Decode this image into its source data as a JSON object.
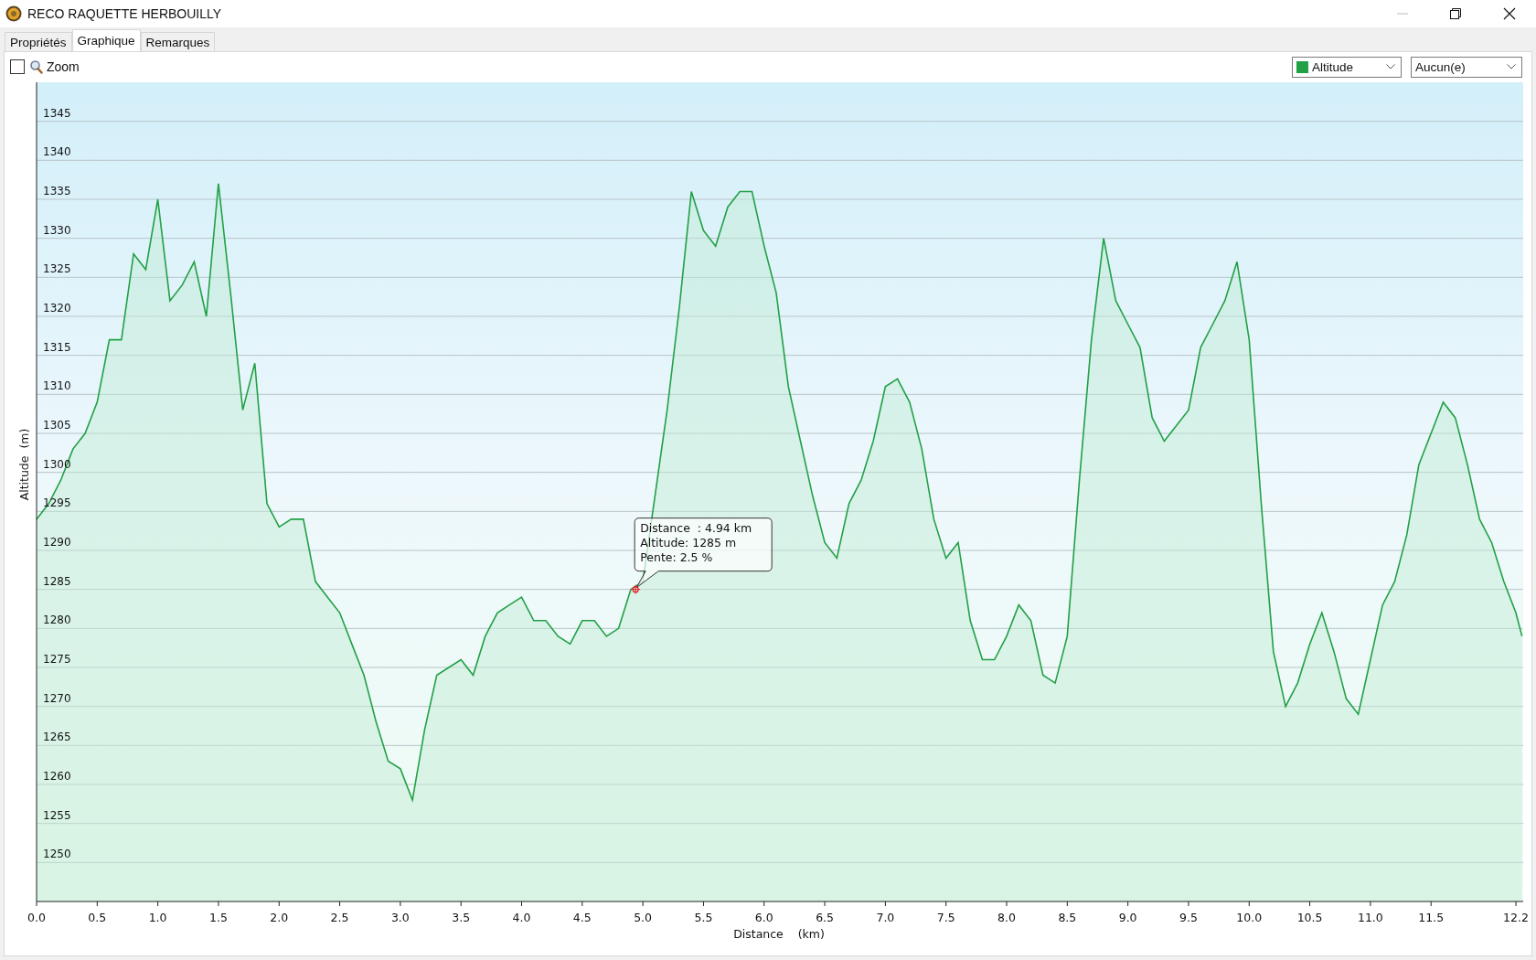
{
  "window": {
    "title": "RECO RAQUETTE HERBOUILLY"
  },
  "tabs": [
    {
      "label": "Propriétés",
      "selected": false
    },
    {
      "label": "Graphique",
      "selected": true
    },
    {
      "label": "Remarques",
      "selected": false
    }
  ],
  "toolbar": {
    "zoom": {
      "label": "Zoom",
      "checked": false
    },
    "series_dropdown": {
      "expanded": false
    },
    "second_dropdown": {
      "value": "Aucun(e)"
    }
  },
  "chart": {
    "chart_data": {
      "type": "area",
      "grid": true,
      "xlabel": "Distance    (km)",
      "ylabel": "Altitude  (m)",
      "x": [
        0,
        0.1,
        0.2,
        0.3,
        0.4,
        0.5,
        0.6,
        0.7,
        0.8,
        0.9,
        1,
        1.1,
        1.2,
        1.3,
        1.4,
        1.5,
        1.6,
        1.7,
        1.8,
        1.9,
        2,
        2.1,
        2.2,
        2.3,
        2.4,
        2.5,
        2.6,
        2.7,
        2.8,
        2.9,
        3,
        3.1,
        3.2,
        3.3,
        3.4,
        3.5,
        3.6,
        3.7,
        3.8,
        3.9,
        4,
        4.1,
        4.2,
        4.3,
        4.4,
        4.5,
        4.6,
        4.7,
        4.8,
        4.9,
        5,
        5.1,
        5.2,
        5.3,
        5.4,
        5.5,
        5.6,
        5.7,
        5.8,
        5.9,
        6,
        6.1,
        6.2,
        6.3,
        6.4,
        6.5,
        6.6,
        6.7,
        6.8,
        6.9,
        7,
        7.1,
        7.2,
        7.3,
        7.4,
        7.5,
        7.6,
        7.7,
        7.8,
        7.9,
        8,
        8.1,
        8.2,
        8.3,
        8.4,
        8.5,
        8.6,
        8.7,
        8.8,
        8.9,
        9,
        9.1,
        9.2,
        9.3,
        9.4,
        9.5,
        9.6,
        9.7,
        9.8,
        9.9,
        10,
        10.1,
        10.2,
        10.3,
        10.4,
        10.5,
        10.6,
        10.7,
        10.8,
        10.9,
        11,
        11.1,
        11.2,
        11.3,
        11.4,
        11.5,
        11.6,
        11.7,
        11.8,
        11.9,
        12,
        12.1,
        12.2,
        12.25
      ],
      "series": [
        {
          "name": "Altitude",
          "color": "#22a046",
          "values": [
            1294,
            1296,
            1299,
            1303,
            1305,
            1309,
            1317,
            1317,
            1328,
            1326,
            1335,
            1322,
            1324,
            1327,
            1320,
            1337,
            1323,
            1308,
            1314,
            1296,
            1293,
            1294,
            1294,
            1286,
            1284,
            1282,
            1278,
            1274,
            1268,
            1263,
            1262,
            1258,
            1267,
            1274,
            1275,
            1276,
            1274,
            1279,
            1282,
            1283,
            1284,
            1281,
            1281,
            1279,
            1278,
            1281,
            1281,
            1279,
            1280,
            1285,
            1286,
            1297,
            1308,
            1321,
            1336,
            1331,
            1329,
            1334,
            1336,
            1336,
            1329,
            1323,
            1311,
            1304,
            1297,
            1291,
            1289,
            1296,
            1299,
            1304,
            1311,
            1312,
            1309,
            1303,
            1294,
            1289,
            1291,
            1281,
            1276,
            1276,
            1279,
            1283,
            1281,
            1274,
            1273,
            1279,
            1299,
            1317,
            1330,
            1322,
            1319,
            1316,
            1307,
            1304,
            1306,
            1308,
            1316,
            1319,
            1322,
            1327,
            1317,
            1296,
            1277,
            1270,
            1273,
            1278,
            1282,
            1277,
            1271,
            1269,
            1276,
            1283,
            1286,
            1292,
            1301,
            1305,
            1309,
            1307,
            1301,
            1294,
            1291,
            1286,
            1282,
            1279
          ]
        }
      ],
      "xlim": [
        0,
        12.26
      ],
      "ylim": [
        1245,
        1350
      ],
      "xticks": [
        {
          "value": 0,
          "label": "0.0"
        },
        {
          "value": 0.5,
          "label": "0.5"
        },
        {
          "value": 1,
          "label": "1.0"
        },
        {
          "value": 1.5,
          "label": "1.5"
        },
        {
          "value": 2,
          "label": "2.0"
        },
        {
          "value": 2.5,
          "label": "2.5"
        },
        {
          "value": 3,
          "label": "3.0"
        },
        {
          "value": 3.5,
          "label": "3.5"
        },
        {
          "value": 4,
          "label": "4.0"
        },
        {
          "value": 4.5,
          "label": "4.5"
        },
        {
          "value": 5,
          "label": "5.0"
        },
        {
          "value": 5.5,
          "label": "5.5"
        },
        {
          "value": 6,
          "label": "6.0"
        },
        {
          "value": 6.5,
          "label": "6.5"
        },
        {
          "value": 7,
          "label": "7.0"
        },
        {
          "value": 7.5,
          "label": "7.5"
        },
        {
          "value": 8,
          "label": "8.0"
        },
        {
          "value": 8.5,
          "label": "8.5"
        },
        {
          "value": 9,
          "label": "9.0"
        },
        {
          "value": 9.5,
          "label": "9.5"
        },
        {
          "value": 10,
          "label": "10.0"
        },
        {
          "value": 10.5,
          "label": "10.5"
        },
        {
          "value": 11,
          "label": "11.0"
        },
        {
          "value": 11.5,
          "label": "11.5"
        },
        {
          "value": 12.2,
          "label": "12.2"
        }
      ],
      "yticks": [
        1250,
        1255,
        1260,
        1265,
        1270,
        1275,
        1280,
        1285,
        1290,
        1295,
        1300,
        1305,
        1310,
        1315,
        1320,
        1325,
        1330,
        1335,
        1340,
        1345
      ],
      "annotations": [
        {
          "x": 4.94,
          "y": 1285,
          "text": "Distance  : 4.94 km\nAltitude: 1285 m\nPente: 2.5 %"
        }
      ]
    }
  }
}
